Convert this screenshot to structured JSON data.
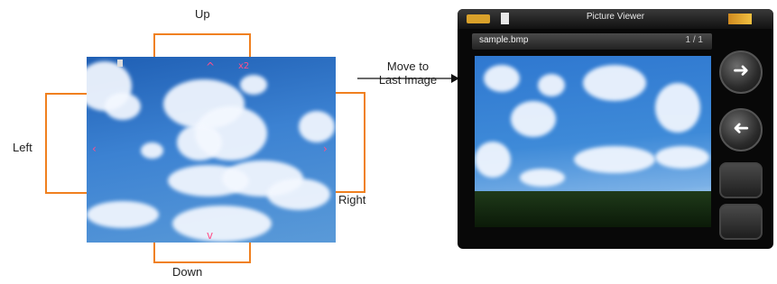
{
  "labels": {
    "up": "Up",
    "down": "Down",
    "left": "Left",
    "right": "Right"
  },
  "arrow": {
    "caption_line1": "Move to",
    "caption_line2": "Last Image"
  },
  "viewer": {
    "app_title": "Picture Viewer",
    "filename": "sample.bmp",
    "counter": "1 / 1"
  },
  "colors": {
    "bracket": "#f0801f",
    "nav_marker": "#ff4f8a",
    "device_body": "#080808"
  },
  "icons": {
    "next_button": "arrow-right-icon",
    "prev_button": "arrow-left-icon"
  }
}
